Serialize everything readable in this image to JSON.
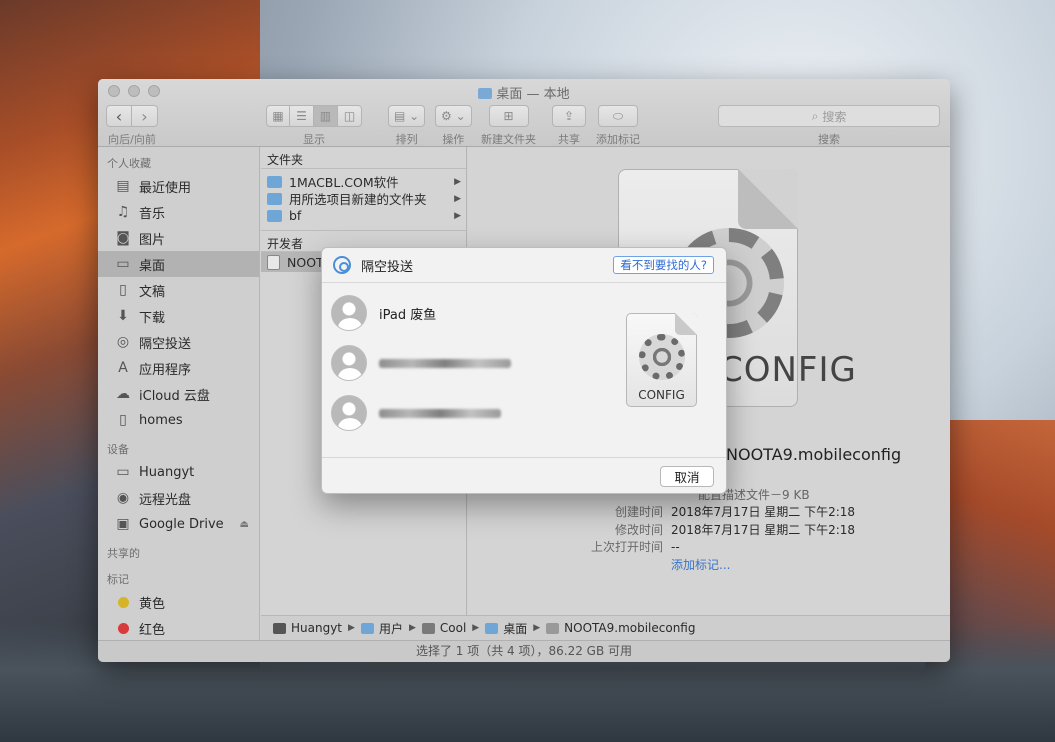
{
  "window": {
    "title": "桌面 — 本地",
    "toolbar": {
      "nav_label": "向后/向前",
      "back": "‹",
      "forward": "›",
      "view_label": "显示",
      "arrange_label": "排列",
      "action_label": "操作",
      "new_folder_label": "新建文件夹",
      "share_label": "共享",
      "tag_label": "添加标记",
      "search_placeholder": "搜索",
      "search_label": "搜索"
    }
  },
  "sidebar": {
    "favorites_heading": "个人收藏",
    "favorites": [
      {
        "label": "最近使用",
        "icon": "recents-icon"
      },
      {
        "label": "音乐",
        "icon": "music-icon"
      },
      {
        "label": "图片",
        "icon": "pictures-icon"
      },
      {
        "label": "桌面",
        "icon": "desktop-icon"
      },
      {
        "label": "文稿",
        "icon": "documents-icon"
      },
      {
        "label": "下载",
        "icon": "downloads-icon"
      },
      {
        "label": "隔空投送",
        "icon": "airdrop-icon"
      },
      {
        "label": "应用程序",
        "icon": "applications-icon"
      },
      {
        "label": "iCloud 云盘",
        "icon": "icloud-icon"
      },
      {
        "label": "homes",
        "icon": "file-icon"
      }
    ],
    "devices_heading": "设备",
    "devices": [
      {
        "label": "Huangyt",
        "icon": "computer-icon"
      },
      {
        "label": "远程光盘",
        "icon": "disc-icon"
      },
      {
        "label": "Google Drive",
        "icon": "drive-icon"
      }
    ],
    "shared_heading": "共享的",
    "tags_heading": "标记",
    "tags": [
      {
        "label": "黄色",
        "color": "#d6b42a"
      },
      {
        "label": "红色",
        "color": "#d63a3a"
      }
    ]
  },
  "column": {
    "folders_heading": "文件夹",
    "folders": [
      "1MACBL.COM软件",
      "用所选项目新建的文件夹",
      "bf"
    ],
    "developer_heading": "开发者",
    "selected_file": "NOOTA9.mobileconfig"
  },
  "preview": {
    "icon_text": "CONFIG",
    "name": "NOOTA9.mobileconfig",
    "kind_size": "配置描述文件－9 KB",
    "meta": [
      {
        "key": "创建时间",
        "value": "2018年7月17日 星期二 下午2:18"
      },
      {
        "key": "修改时间",
        "value": "2018年7月17日 星期二 下午2:18"
      },
      {
        "key": "上次打开时间",
        "value": "--"
      }
    ],
    "add_tags": "添加标记..."
  },
  "pathbar": [
    {
      "label": "Huangyt",
      "color": "#555555"
    },
    {
      "label": "用户",
      "color": "#6fa6d8"
    },
    {
      "label": "Cool",
      "color": "#7a7a7a"
    },
    {
      "label": "桌面",
      "color": "#6fa6d8"
    },
    {
      "label": "NOOTA9.mobileconfig",
      "color": "#999999"
    }
  ],
  "status": "选择了 1 项（共 4 项），86.22 GB 可用",
  "airdrop": {
    "title": "隔空投送",
    "help_button": "看不到要找的人?",
    "people": [
      {
        "name": "iPad 废鱼",
        "blurred": false
      },
      {
        "name": "",
        "blurred": true
      },
      {
        "name": "",
        "blurred": true
      }
    ],
    "file_icon_text": "CONFIG",
    "cancel": "取消"
  }
}
